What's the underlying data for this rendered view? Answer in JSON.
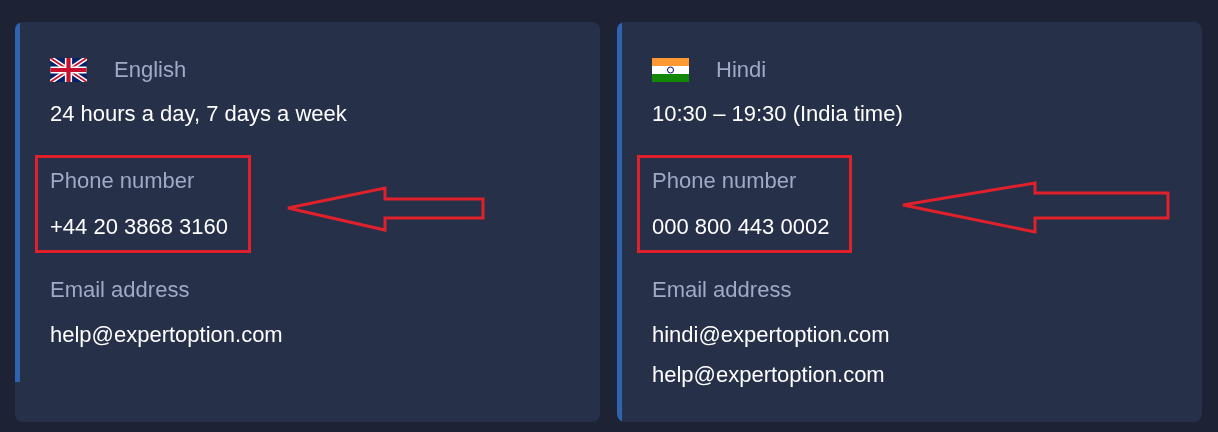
{
  "cards": [
    {
      "flag": {
        "kind": "uk"
      },
      "language": "English",
      "hours": "24 hours a day, 7 days a week",
      "phone": {
        "label": "Phone number",
        "number": "+44 20 3868 3160",
        "highlighted": true
      },
      "email": {
        "label": "Email address",
        "addresses": [
          "help@expertoption.com"
        ]
      }
    },
    {
      "flag": {
        "kind": "in"
      },
      "language": "Hindi",
      "hours": "10:30 – 19:30 (India time)",
      "phone": {
        "label": "Phone number",
        "number": "000 800 443 0002",
        "highlighted": true
      },
      "email": {
        "label": "Email address",
        "addresses": [
          "hindi@expertoption.com",
          "help@expertoption.com"
        ]
      }
    }
  ]
}
